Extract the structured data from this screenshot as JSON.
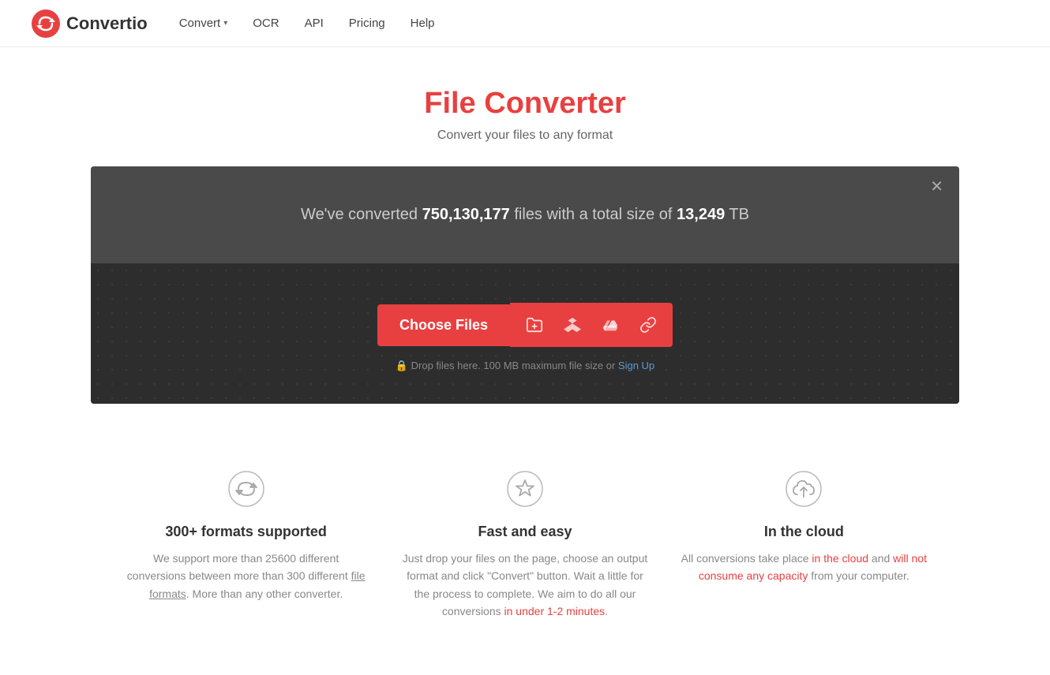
{
  "nav": {
    "logo_text": "Convertio",
    "links": [
      {
        "id": "convert",
        "label": "Convert",
        "has_dropdown": true
      },
      {
        "id": "ocr",
        "label": "OCR",
        "has_dropdown": false
      },
      {
        "id": "api",
        "label": "API",
        "has_dropdown": false
      },
      {
        "id": "pricing",
        "label": "Pricing",
        "has_dropdown": false
      },
      {
        "id": "help",
        "label": "Help",
        "has_dropdown": false
      }
    ]
  },
  "hero": {
    "title": "File Converter",
    "subtitle": "Convert your files to any format"
  },
  "upload": {
    "stats_text_before": "We've converted ",
    "files_count": "750,130,177",
    "stats_text_middle": " files with a total size of ",
    "total_size": "13,249",
    "stats_text_after": " TB",
    "choose_files_label": "Choose Files",
    "drop_text": "Drop files here. 100 MB maximum file size or ",
    "sign_up_label": "Sign Up"
  },
  "features": [
    {
      "id": "formats",
      "title": "300+ formats supported",
      "desc": "We support more than 25600 different conversions between more than 300 different file formats. More than any other converter.",
      "icon": "refresh-icon"
    },
    {
      "id": "speed",
      "title": "Fast and easy",
      "desc": "Just drop your files on the page, choose an output format and click \"Convert\" button. Wait a little for the process to complete. We aim to do all our conversions in under 1-2 minutes.",
      "icon": "star-icon"
    },
    {
      "id": "cloud",
      "title": "In the cloud",
      "desc": "All conversions take place in the cloud and will not consume any capacity from your computer.",
      "icon": "cloud-icon"
    }
  ],
  "colors": {
    "brand_red": "#e84040",
    "dark_bg": "#3a3a3a",
    "darker_bg": "#2d2d2d",
    "stats_bg": "#4a4a4a"
  }
}
